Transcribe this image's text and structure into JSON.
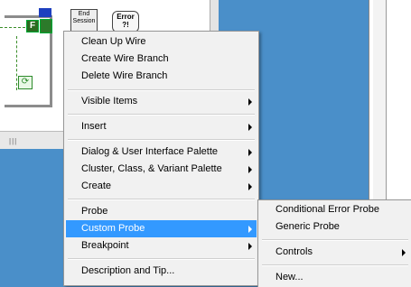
{
  "diagram": {
    "node_f_label": "F",
    "end_session_label": "End Session",
    "error_vi_label": "Error ?!",
    "loop_icon": "loop-iteration-icon"
  },
  "context_menu": {
    "items": [
      {
        "label": "Clean Up Wire"
      },
      {
        "label": "Create Wire Branch"
      },
      {
        "label": "Delete Wire Branch"
      },
      {
        "label": "Visible Items"
      },
      {
        "label": "Insert"
      },
      {
        "label": "Dialog & User Interface Palette"
      },
      {
        "label": "Cluster, Class, & Variant Palette"
      },
      {
        "label": "Create"
      },
      {
        "label": "Probe"
      },
      {
        "label": "Custom Probe"
      },
      {
        "label": "Breakpoint"
      },
      {
        "label": "Description and Tip..."
      }
    ]
  },
  "submenu": {
    "items": [
      {
        "label": "Conditional Error Probe"
      },
      {
        "label": "Generic Probe"
      },
      {
        "label": "Controls"
      },
      {
        "label": "New..."
      }
    ]
  },
  "colors": {
    "highlight": "#3399ff",
    "desktop": "#4a8fc9"
  }
}
